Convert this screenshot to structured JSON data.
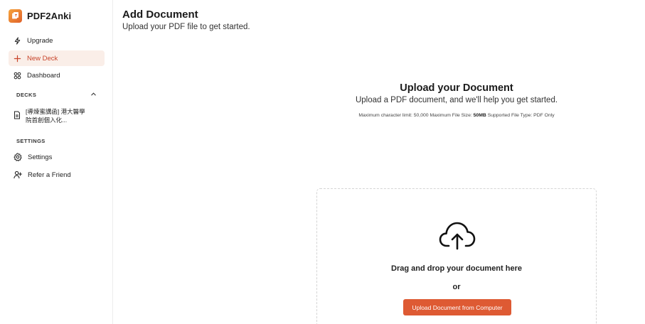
{
  "app": {
    "name": "PDF2Anki"
  },
  "sidebar": {
    "nav": [
      {
        "label": "Upgrade",
        "icon": "lightning-icon"
      },
      {
        "label": "New Deck",
        "icon": "plus-icon",
        "active": true
      },
      {
        "label": "Dashboard",
        "icon": "grid-icon"
      }
    ],
    "decks_label": "DECKS",
    "decks": [
      {
        "title": "[導煉蜜講函] 港大醫學院首創個入化...",
        "icon": "document-icon"
      }
    ],
    "settings_label": "SETTINGS",
    "settings_items": [
      {
        "label": "Settings",
        "icon": "gear-icon"
      },
      {
        "label": "Refer a Friend",
        "icon": "user-plus-icon"
      }
    ]
  },
  "main": {
    "title": "Add Document",
    "subtitle": "Upload your PDF file to get started."
  },
  "upload": {
    "title": "Upload your Document",
    "description": "Upload a PDF document, and we'll help you get started.",
    "limits_prefix": "Maximum character limit: 50,000 Maximum File Size:",
    "max_size": "50MB",
    "limits_suffix": "Supported File Type: PDF Only",
    "drop_text": "Drag and drop your document here",
    "or_text": "or",
    "button_label": "Upload Document from Computer",
    "accent_color": "#de5a33"
  }
}
